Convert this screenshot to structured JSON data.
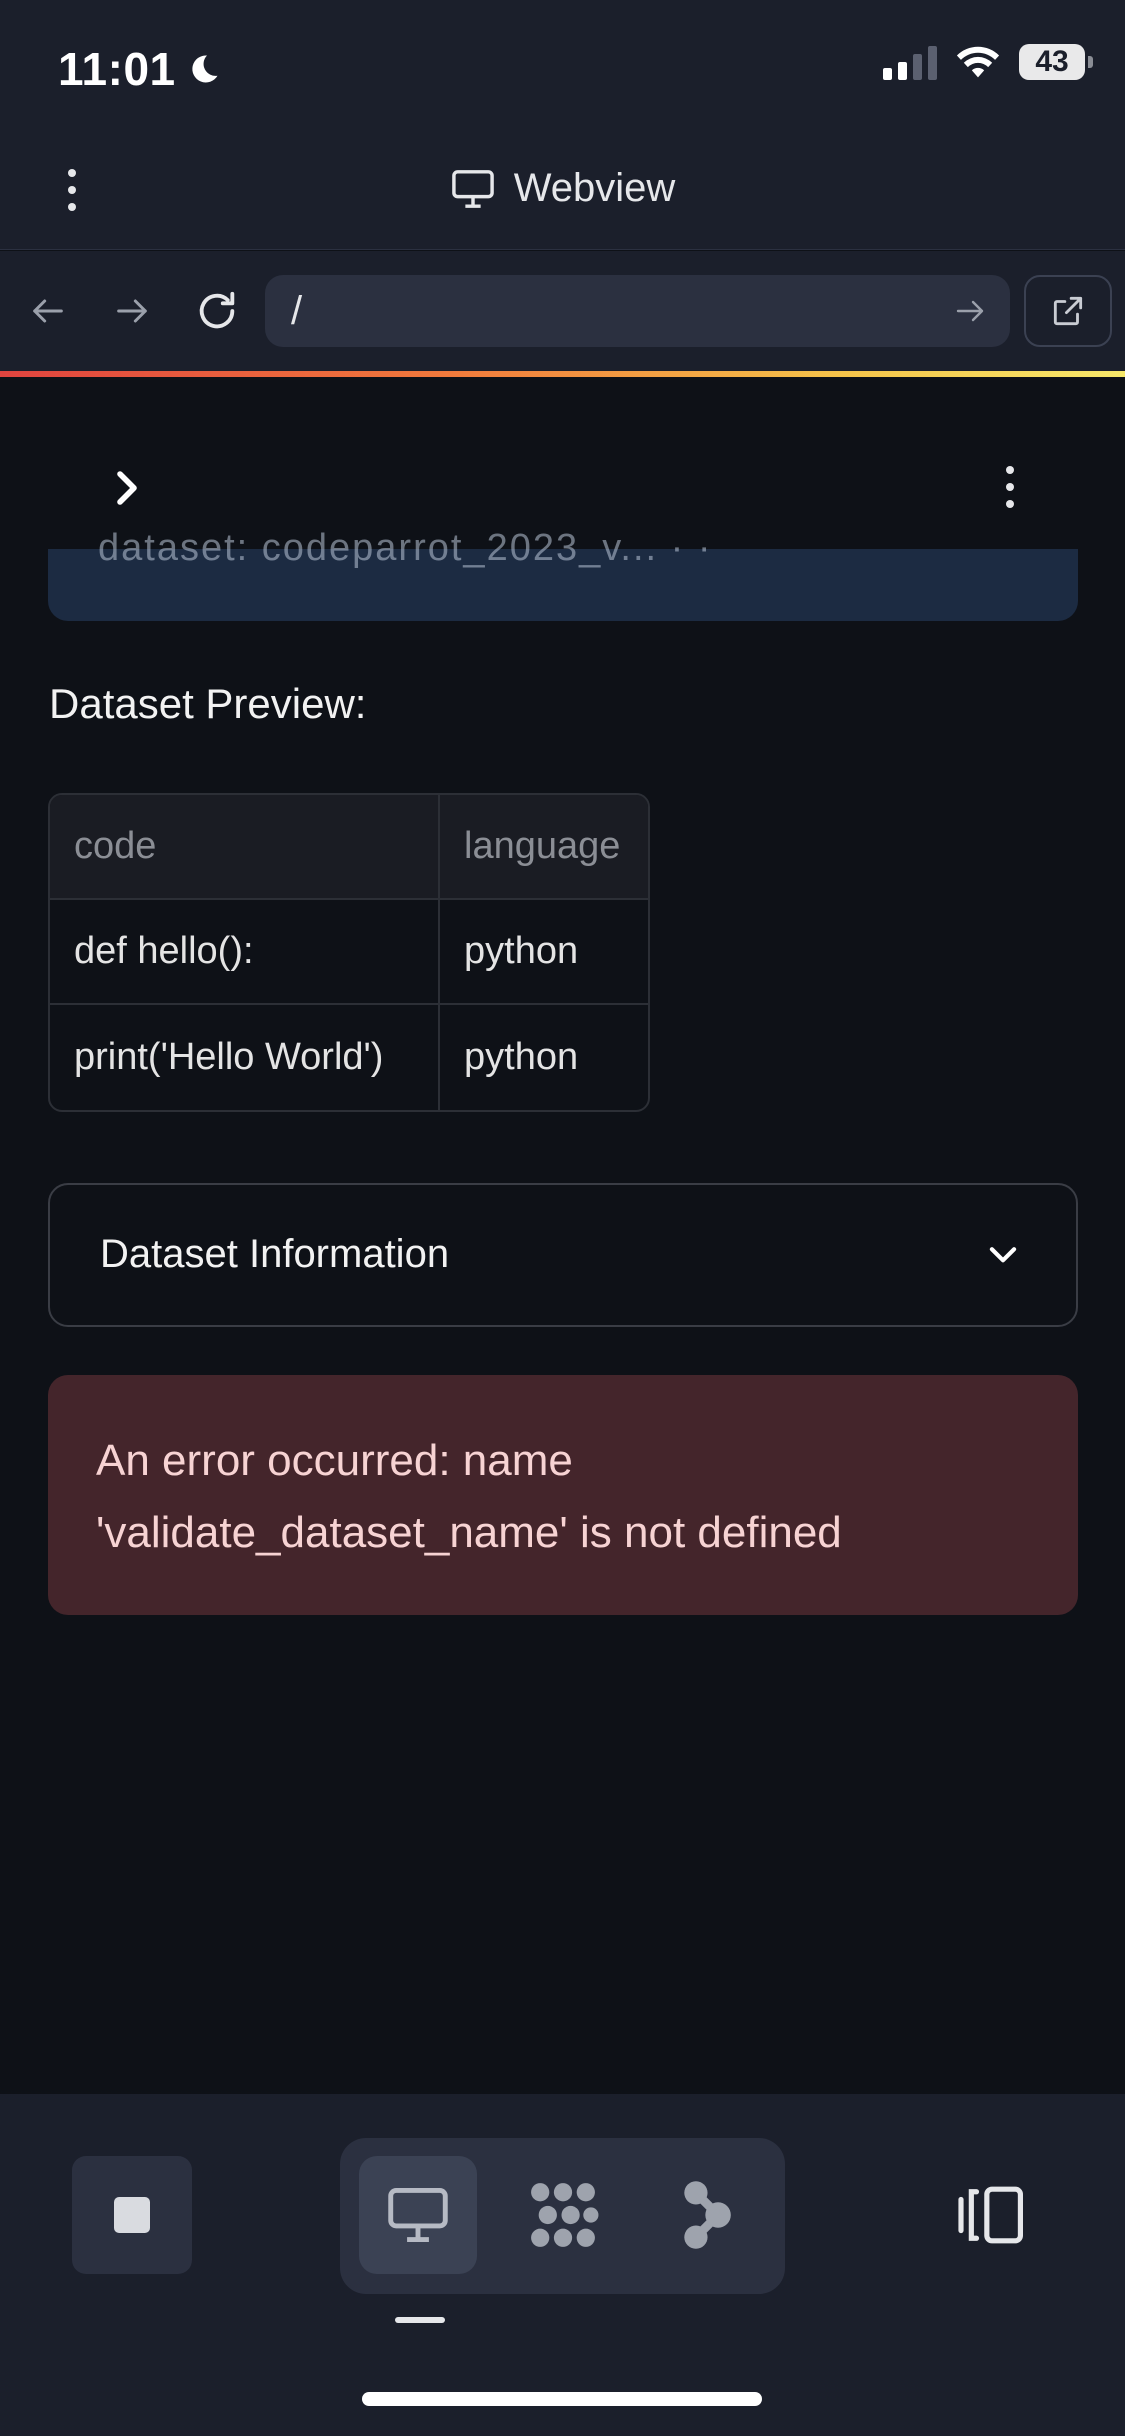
{
  "status_bar": {
    "time": "11:01",
    "battery": "43"
  },
  "header": {
    "title": "Webview"
  },
  "url_bar": {
    "url": "/"
  },
  "content": {
    "code_cut_text": "dataset: codeparrot_2023_v... · ·",
    "preview_label": "Dataset Preview:",
    "table": {
      "columns": [
        "code",
        "language"
      ],
      "rows": [
        [
          "def hello():",
          "python"
        ],
        [
          "print('Hello World')",
          "python"
        ]
      ]
    },
    "expander_label": "Dataset Information",
    "error_text": "An error occurred: name 'validate_dataset_name' is not defined"
  },
  "colors": {
    "background": "#0e1117",
    "chrome": "#1b1f2b",
    "error_bg": "#44252b",
    "error_text": "#f7d3d3"
  }
}
